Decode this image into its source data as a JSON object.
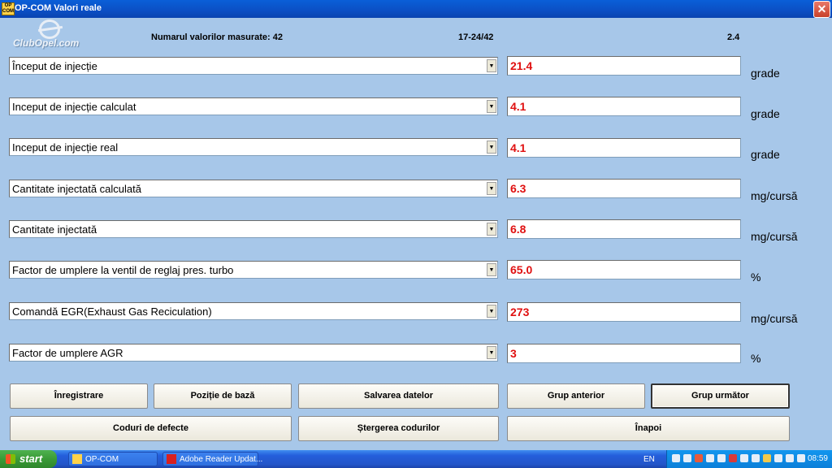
{
  "window": {
    "title": "OP-COM  Valori reale",
    "icon_label": "OP COM",
    "close_symbol": "✕"
  },
  "logo": {
    "text": "ClubOpel.com"
  },
  "header": {
    "count_label": "Numarul valorilor masurate: 42",
    "range": "17-24/42",
    "version": "2.4"
  },
  "rows": [
    {
      "label": "Început de injecție",
      "value": "21.4",
      "unit": "grade"
    },
    {
      "label": "Inceput de injecție calculat",
      "value": "4.1",
      "unit": "grade"
    },
    {
      "label": "Inceput de injecție real",
      "value": "4.1",
      "unit": "grade"
    },
    {
      "label": "Cantitate injectată calculată",
      "value": "6.3",
      "unit": "mg/cursă"
    },
    {
      "label": "Cantitate injectată",
      "value": "6.8",
      "unit": "mg/cursă"
    },
    {
      "label": "Factor de umplere la ventil  de reglaj pres. turbo",
      "value": "65.0",
      "unit": "%"
    },
    {
      "label": "Comandă EGR(Exhaust Gas Reciculation)",
      "value": "273",
      "unit": "mg/cursă"
    },
    {
      "label": "Factor de umplere AGR",
      "value": "3",
      "unit": "%"
    }
  ],
  "buttons": {
    "record": "Înregistrare",
    "base_position": "Poziție de bază",
    "save_data": "Salvarea datelor",
    "prev_group": "Grup anterior",
    "next_group": "Grup următor",
    "fault_codes": "Coduri de defecte",
    "clear_codes": "Ștergerea codurilor",
    "back": "Înapoi"
  },
  "taskbar": {
    "start": "start",
    "items": [
      "OP-COM",
      "Adobe Reader Updat..."
    ],
    "language": "EN",
    "clock": "08:59"
  },
  "icons": {
    "dropdown": "chevron-down-icon",
    "start": "windows-flag-icon"
  }
}
